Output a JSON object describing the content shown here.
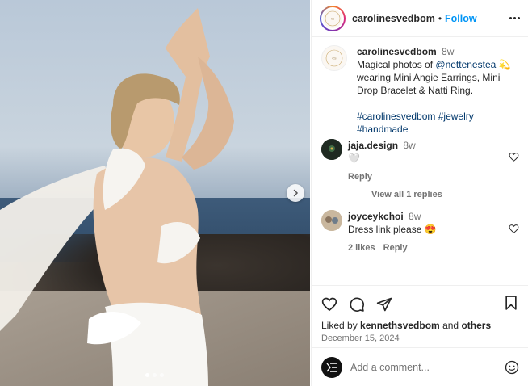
{
  "post": {
    "username": "carolinesvedbom",
    "follow_label": "Follow",
    "separator": "•",
    "caption": {
      "username": "carolinesvedbom",
      "time": "8w",
      "text_before_mention": "Magical photos of ",
      "mention": "@nettenestea",
      "emoji": "💫",
      "text_after_mention": "wearing Mini Angie Earrings, Mini Drop Bracelet & Natti Ring.",
      "hashtags": "#carolinesvedbom #jewelry #handmade"
    },
    "comments": [
      {
        "username": "jaja.design",
        "time": "8w",
        "text": "🤍",
        "reply_label": "Reply",
        "view_replies": "View all 1 replies"
      },
      {
        "username": "joyceykchoi",
        "time": "8w",
        "text": "Dress link please 😍",
        "likes": "2 likes",
        "reply_label": "Reply"
      }
    ],
    "liked_by_prefix": "Liked by ",
    "liked_by_user": "kennethsvedbom",
    "liked_by_middle": " and ",
    "liked_by_others": "others",
    "date": "December 15, 2024",
    "add_comment_placeholder": "Add a comment...",
    "avatar_logo_text": "CAROLINE SVEDBOM"
  },
  "carousel": {
    "slides": 3,
    "active": 0
  },
  "colors": {
    "accent": "#0095f6",
    "link": "#00376b",
    "muted": "#737373"
  },
  "icons": [
    "more-icon",
    "heart-icon",
    "comment-icon",
    "share-icon",
    "bookmark-icon",
    "emoji-icon",
    "chevron-right-icon"
  ]
}
